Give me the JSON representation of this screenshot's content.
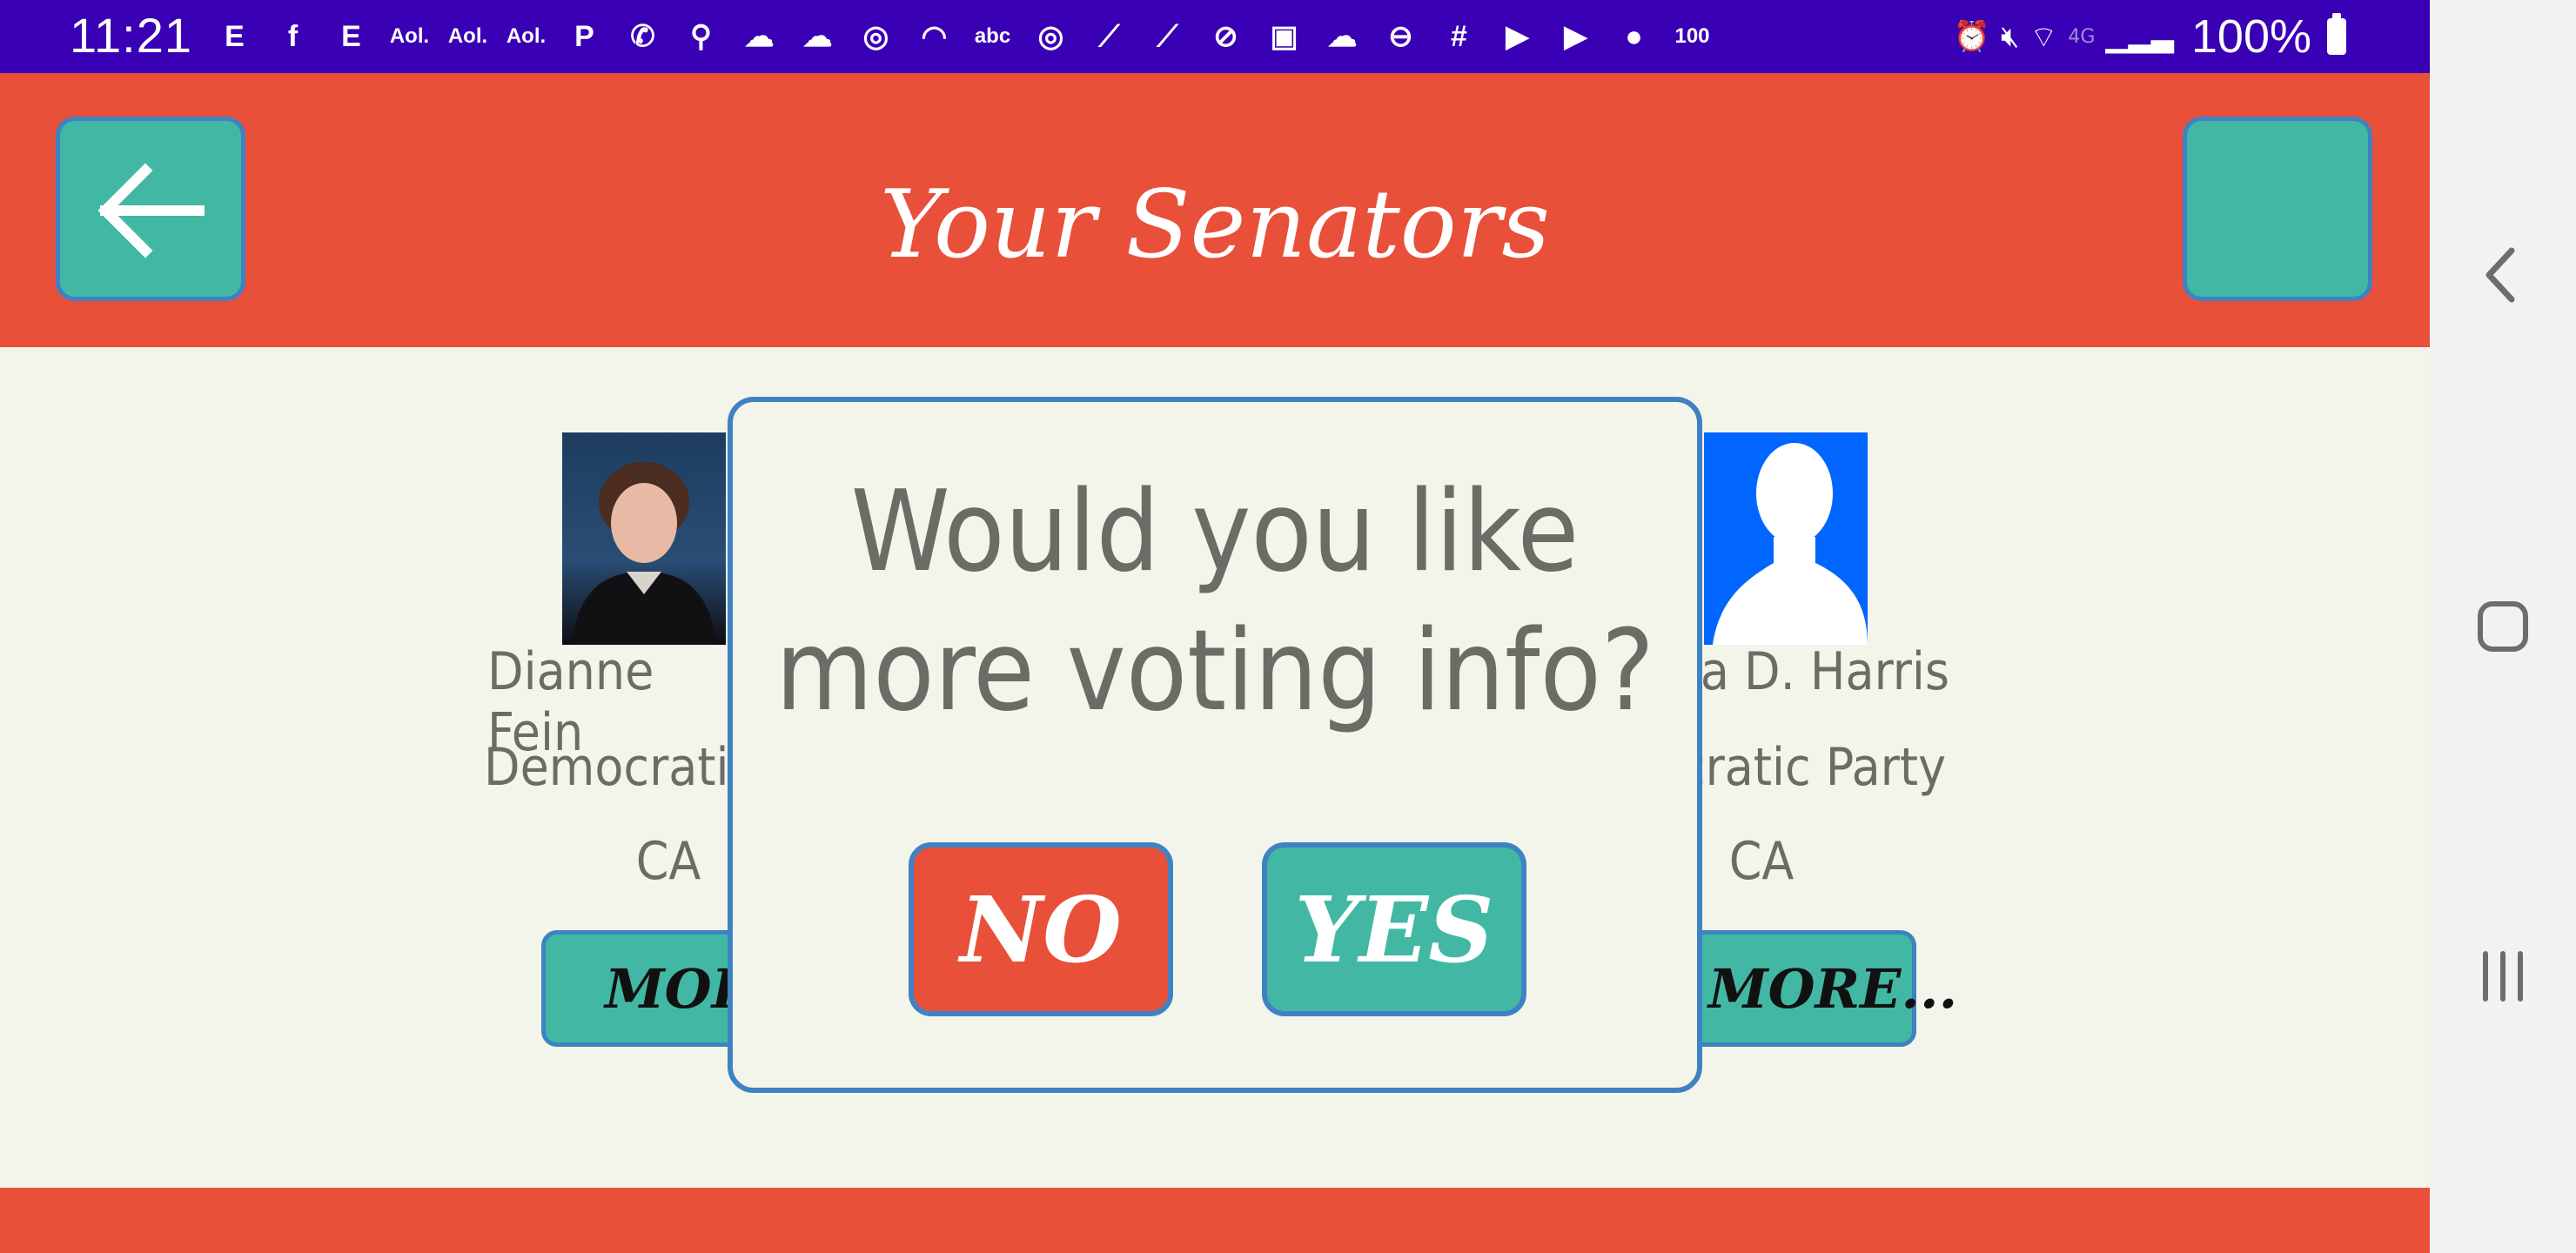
{
  "status_bar": {
    "time": "11:21",
    "notification_icons": [
      "E",
      "f",
      "E",
      "Aol.",
      "Aol.",
      "Aol.",
      "P",
      "✆",
      "⚲",
      "☁",
      "☁",
      "◎",
      "◠",
      "abc",
      "◎",
      "⟋",
      "⟋",
      "⊘",
      "▣",
      "☁",
      "⊖",
      "#",
      "▶",
      "▶",
      "●",
      "100"
    ],
    "battery_percent": "100%",
    "network_label": "4G"
  },
  "header": {
    "title": "Your Senators",
    "back_icon": "arrow-left-icon"
  },
  "senators": [
    {
      "name": "Dianne Fein",
      "party": "Democratic",
      "state": "CA",
      "more_label": "MORE"
    },
    {
      "name": "la D. Harris",
      "party": "cratic Party",
      "state": "CA",
      "more_label": "MORE..."
    }
  ],
  "dialog": {
    "message_line1": "Would you like",
    "message_line2": "more voting info?",
    "no_label": "NO",
    "yes_label": "YES"
  },
  "colors": {
    "status_bar": "#3a00b5",
    "header": "#e8503a",
    "button_teal": "#42b8a4",
    "button_border": "#3f82c4",
    "background": "#f4f5ea",
    "text_gray": "#6c6c66"
  }
}
